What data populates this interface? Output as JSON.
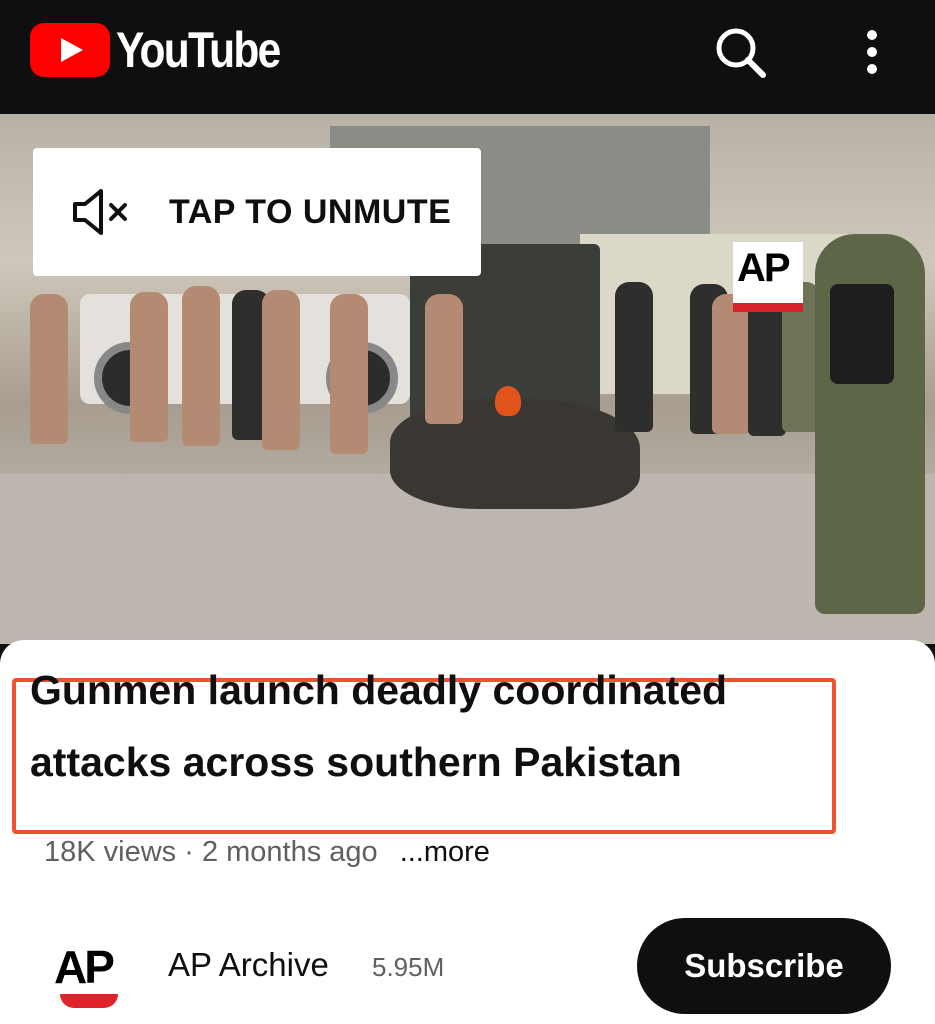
{
  "header": {
    "logo_text": "YouTube",
    "icons": [
      "search-icon",
      "more-vert-icon"
    ]
  },
  "video": {
    "unmute_label": "TAP TO UNMUTE",
    "unmute_icon": "volume-off-icon",
    "watermark": "AP"
  },
  "info": {
    "title": "Gunmen launch deadly coordinated attacks across southern Pakistan",
    "views": "18K views",
    "separator": " · ",
    "age": "2 months ago",
    "more_label": "...more",
    "channel": {
      "logo_text": "AP",
      "name": "AP Archive",
      "subscribers": "5.95M",
      "subscribe_label": "Subscribe"
    }
  },
  "colors": {
    "brand_red": "#ff0000",
    "highlight_border": "#f0522d",
    "ap_red": "#d6232b"
  }
}
